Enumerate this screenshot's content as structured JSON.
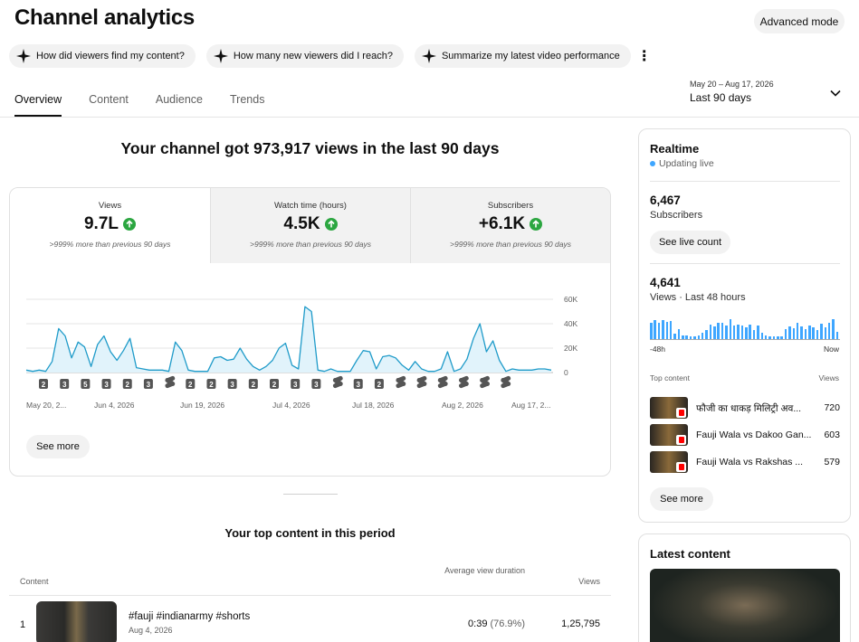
{
  "header": {
    "title": "Channel analytics",
    "advanced_mode": "Advanced mode"
  },
  "chips": [
    {
      "label": "How did viewers find my content?"
    },
    {
      "label": "How many new viewers did I reach?"
    },
    {
      "label": "Summarize my latest video performance"
    }
  ],
  "tabs": [
    {
      "label": "Overview",
      "active": true
    },
    {
      "label": "Content"
    },
    {
      "label": "Audience"
    },
    {
      "label": "Trends"
    }
  ],
  "date_range": {
    "range": "May 20 – Aug 17, 2026",
    "label": "Last 90 days"
  },
  "headline": "Your channel got 973,917 views in the last 90 days",
  "metrics": [
    {
      "label": "Views",
      "value": "9.7L",
      "note": ">999% more than previous 90 days"
    },
    {
      "label": "Watch time (hours)",
      "value": "4.5K",
      "note": ">999% more than previous 90 days"
    },
    {
      "label": "Subscribers",
      "value": "+6.1K",
      "note": ">999% more than previous 90 days"
    }
  ],
  "chart_data": {
    "type": "area",
    "series": [
      {
        "values": [
          2,
          1,
          2,
          1,
          9,
          36,
          30,
          12,
          25,
          21,
          5,
          23,
          30,
          17,
          10,
          18,
          28,
          4,
          3,
          2,
          2,
          2,
          1,
          25,
          18,
          2,
          1,
          1,
          1,
          12,
          13,
          10,
          11,
          20,
          11,
          5,
          2,
          5,
          10,
          20,
          24,
          6,
          3,
          54,
          50,
          2,
          1,
          3,
          1,
          1,
          1,
          10,
          18,
          17,
          3,
          13,
          14,
          12,
          6,
          2,
          9,
          3,
          1,
          1,
          3,
          17,
          1,
          3,
          11,
          28,
          40,
          17,
          26,
          10,
          1,
          3,
          2,
          2,
          2,
          3,
          3,
          2
        ]
      }
    ],
    "x_tick_labels": [
      "May 20, 2...",
      "Jun 4, 2026",
      "Jun 19, 2026",
      "Jul 4, 2026",
      "Jul 18, 2026",
      "Aug 2, 2026",
      "Aug 17, 2..."
    ],
    "y_tick_labels": [
      "60K",
      "40K",
      "20K",
      "0"
    ],
    "ylim": [
      0,
      60
    ],
    "ylabel_unit": "K",
    "grid": true,
    "upload_markers": [
      "2",
      "3",
      "5",
      "3",
      "2",
      "3",
      "shorts-icon",
      "2",
      "2",
      "3",
      "2",
      "2",
      "3",
      "3",
      "shorts-icon",
      "3",
      "2",
      "shorts-icon",
      "shorts-icon",
      "shorts-icon",
      "shorts-icon",
      "shorts-icon",
      "shorts-icon"
    ]
  },
  "see_more": "See more",
  "top_content": {
    "title": "Your top content in this period",
    "columns": {
      "content": "Content",
      "avd": "Average view duration",
      "views": "Views"
    },
    "rows": [
      {
        "rank": "1",
        "title": "#fauji #indianarmy #shorts",
        "date": "Aug 4, 2026",
        "avd": "0:39",
        "avd_pct": "(76.9%)",
        "views": "1,25,795"
      }
    ]
  },
  "realtime": {
    "title": "Realtime",
    "status": "Updating live",
    "subscribers": "6,467",
    "subscribers_label": "Subscribers",
    "see_live_count": "See live count",
    "views": "4,641",
    "views_label": "Views · Last 48 hours",
    "bars": [
      18,
      21,
      18,
      21,
      19,
      20,
      6,
      11,
      4,
      4,
      3,
      3,
      4,
      7,
      10,
      16,
      14,
      18,
      18,
      15,
      22,
      15,
      16,
      15,
      13,
      16,
      10,
      15,
      7,
      4,
      3,
      3,
      3,
      3,
      11,
      14,
      12,
      18,
      14,
      11,
      15,
      13,
      10,
      17,
      13,
      18,
      22,
      8
    ],
    "axis_start": "-48h",
    "axis_end": "Now",
    "top_content_label": "Top content",
    "views_col": "Views",
    "items": [
      {
        "title": "फौजी का धाकड़ मिलिट्री अव...",
        "views": "720"
      },
      {
        "title": "Fauji Wala vs Dakoo Gan...",
        "views": "603"
      },
      {
        "title": "Fauji Wala vs Rakshas ...",
        "views": "579"
      }
    ],
    "see_more": "See more"
  },
  "latest_content": {
    "title": "Latest content"
  },
  "colors": {
    "accent": "#3ea6ff",
    "line": "#1f9bc9",
    "area": "#e1f3fb",
    "up": "#2ba640"
  }
}
